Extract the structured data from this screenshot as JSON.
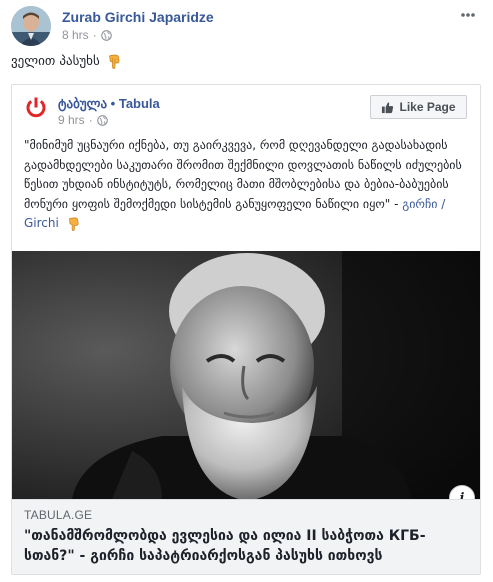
{
  "post": {
    "author": "Zurab Girchi Japaridze",
    "time": "8 hrs",
    "separator": "·",
    "text": "ველით პასუხს",
    "emoji": "pointing-down-hand"
  },
  "shared": {
    "page_name": "ტაბულა • Tabula",
    "time": "9 hrs",
    "separator": "·",
    "like_label": "Like Page",
    "quote": "\"მინიმუმ უცნაური იქნება, თუ გაირკვევა, რომ დღევანდელი გადასახადის გადამხდელები საკუთარი შრომით შექმნილი დოვლათის ნაწილს იძულების წესით უხდიან ინსტიტუტს, რომელიც მათი მშობლებისა და ბებია-ბაბუების მონური ყოფის შემოქმედი სისტემის განუყოფელი ნაწილი იყო\" - ",
    "quote_tag": "გირჩი / Girchi",
    "link": {
      "domain": "TABULA.GE",
      "title": "\"თანამშრომლობდა ევლესია და ილია II საბჭოთა КГБ-სთან?\" - გირჩი საპატრიარქოსგან პასუხს ითხოვს"
    }
  },
  "colors": {
    "link_blue": "#385898",
    "meta_gray": "#90949c",
    "tabula_red": "#e0262b"
  }
}
